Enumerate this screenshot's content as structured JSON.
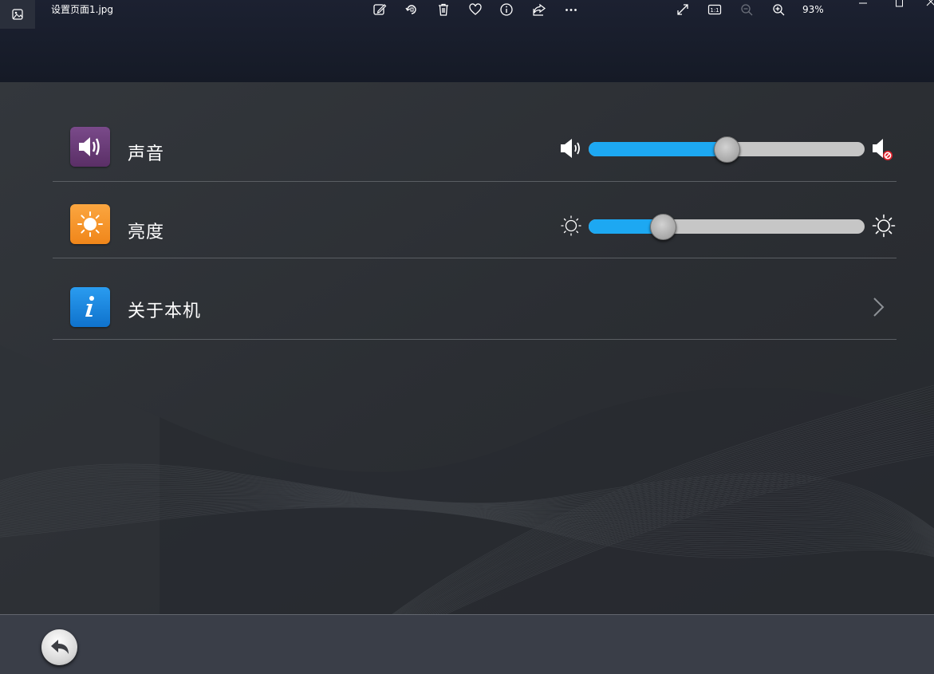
{
  "viewer": {
    "file_name": "设置页面1.jpg",
    "zoom_level": "93%",
    "toolbar_icons": [
      "edit-image-icon",
      "rotate-icon",
      "delete-icon",
      "favorite-icon",
      "info-icon",
      "share-icon",
      "more-icon"
    ],
    "zoom_icons": [
      "fullscreen-icon",
      "actual-size-icon",
      "zoom-out-icon",
      "zoom-in-icon"
    ],
    "actual_size_label": "1:1"
  },
  "settings": {
    "rows": [
      {
        "label": "声音",
        "icon": "speaker-icon",
        "icon_color": "#6a3b78",
        "control": "slider",
        "value": 0.5,
        "min_icon": "speaker-low-icon",
        "max_icon": "speaker-mute-icon"
      },
      {
        "label": "亮度",
        "icon": "sun-icon",
        "icon_color": "#f79420",
        "control": "slider",
        "value": 0.27,
        "min_icon": "sun-dim-icon",
        "max_icon": "sun-bright-icon"
      },
      {
        "label": "关于本机",
        "icon": "info-icon",
        "icon_color": "#1a8be0",
        "control": "chevron"
      }
    ],
    "accent_color": "#1da8f2"
  },
  "bottom": {
    "back_icon": "back-arrow-icon"
  }
}
